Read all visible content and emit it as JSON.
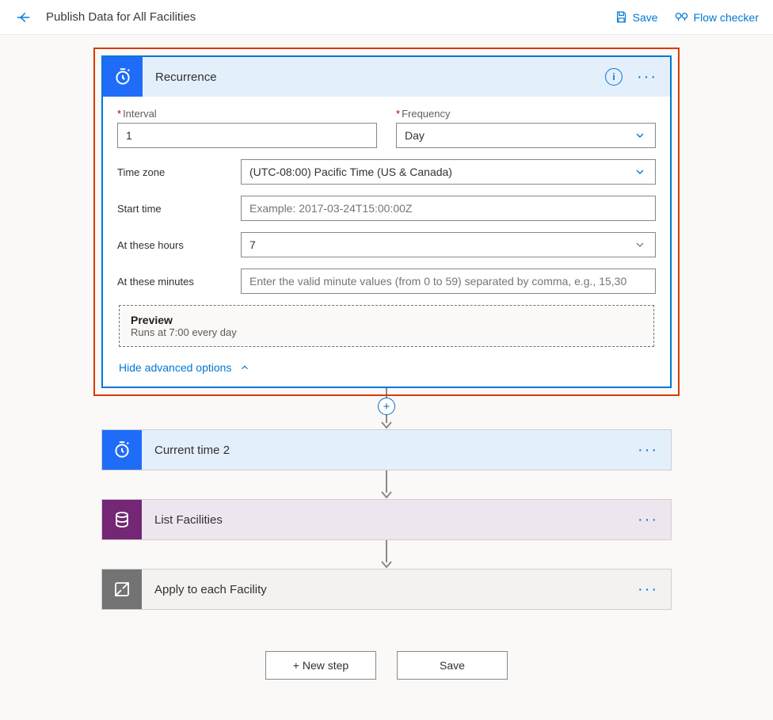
{
  "header": {
    "title": "Publish Data for All Facilities",
    "save": "Save",
    "flowChecker": "Flow checker"
  },
  "recurrence": {
    "title": "Recurrence",
    "intervalLabel": "Interval",
    "intervalValue": "1",
    "frequencyLabel": "Frequency",
    "frequencyValue": "Day",
    "timezoneLabel": "Time zone",
    "timezoneValue": "(UTC-08:00) Pacific Time (US & Canada)",
    "startTimeLabel": "Start time",
    "startTimePlaceholder": "Example: 2017-03-24T15:00:00Z",
    "hoursLabel": "At these hours",
    "hoursValue": "7",
    "minutesLabel": "At these minutes",
    "minutesPlaceholder": "Enter the valid minute values (from 0 to 59) separated by comma, e.g., 15,30",
    "previewTitle": "Preview",
    "previewText": "Runs at 7:00 every day",
    "hideAdvanced": "Hide advanced options"
  },
  "steps": {
    "currentTime": "Current time 2",
    "listFacilities": "List Facilities",
    "applyEach": "Apply to each Facility"
  },
  "footer": {
    "newStep": "+ New step",
    "save": "Save"
  },
  "colors": {
    "primary": "#0078d4",
    "schedule": "#1f6cf9",
    "dataverse": "#742774",
    "control": "#737373",
    "highlight": "#d83b01"
  }
}
